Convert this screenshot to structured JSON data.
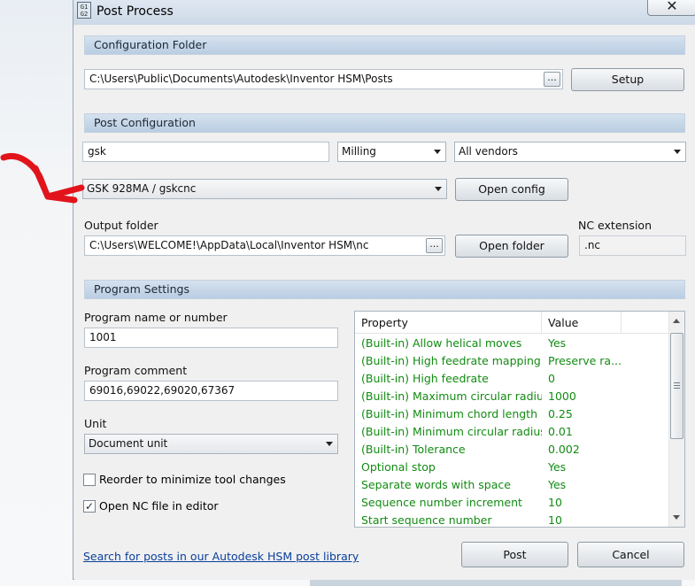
{
  "window": {
    "title": "Post Process",
    "icon_text": "G1 G2",
    "close_glyph": "✕"
  },
  "config_folder": {
    "header": "Configuration Folder",
    "path": "C:\\Users\\Public\\Documents\\Autodesk\\Inventor HSM\\Posts",
    "browse_label": "...",
    "setup_label": "Setup"
  },
  "post_config": {
    "header": "Post Configuration",
    "search_value": "gsk",
    "machine_type": "Milling",
    "vendor": "All vendors",
    "post": "GSK 928MA / gskcnc",
    "open_config_label": "Open config",
    "output_folder_label": "Output folder",
    "output_folder": "C:\\Users\\WELCOME!\\AppData\\Local\\Inventor HSM\\nc",
    "output_browse_label": "...",
    "open_folder_label": "Open folder",
    "nc_extension_label": "NC extension",
    "nc_extension": ".nc"
  },
  "program_settings": {
    "header": "Program Settings",
    "program_name_label": "Program name or number",
    "program_name": "1001",
    "program_comment_label": "Program comment",
    "program_comment": "69016,69022,69020,67367",
    "unit_label": "Unit",
    "unit_value": "Document unit",
    "reorder_label": "Reorder to minimize tool changes",
    "reorder_checked": false,
    "open_nc_label": "Open NC file in editor",
    "open_nc_checked": true,
    "check_glyph": "✓"
  },
  "properties": {
    "columns": [
      "Property",
      "Value"
    ],
    "rows": [
      {
        "property": "(Built-in) Allow helical moves",
        "value": "Yes"
      },
      {
        "property": "(Built-in) High feedrate mapping",
        "value": "Preserve ra..."
      },
      {
        "property": "(Built-in) High feedrate",
        "value": "0"
      },
      {
        "property": "(Built-in) Maximum circular radius",
        "value": "1000"
      },
      {
        "property": "(Built-in) Minimum chord length",
        "value": "0.25"
      },
      {
        "property": "(Built-in) Minimum circular radius",
        "value": "0.01"
      },
      {
        "property": "(Built-in) Tolerance",
        "value": "0.002"
      },
      {
        "property": "Optional stop",
        "value": "Yes"
      },
      {
        "property": "Separate words with space",
        "value": "Yes"
      },
      {
        "property": "Sequence number increment",
        "value": "10"
      },
      {
        "property": "Start sequence number",
        "value": "10"
      }
    ],
    "text_color": "#128b12"
  },
  "footer": {
    "link_text": "Search for posts in our Autodesk HSM post library",
    "post_label": "Post",
    "cancel_label": "Cancel"
  },
  "annotation": {
    "arrow_color": "#e2141b"
  }
}
